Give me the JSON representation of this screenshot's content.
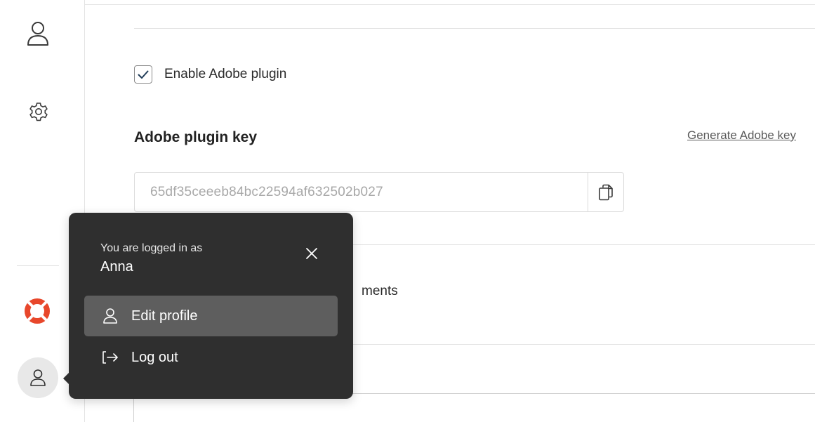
{
  "sidebar": {
    "icons": {
      "profile": "user-icon",
      "settings": "gear-icon",
      "help": "lifebuoy-icon",
      "account": "user-icon"
    },
    "help_colors": [
      "#e8472b",
      "#ffffff"
    ]
  },
  "settings": {
    "enable_adobe_label": "Enable Adobe plugin",
    "enable_adobe_checked": true,
    "plugin_key_title": "Adobe plugin key",
    "generate_key_link": "Generate Adobe key",
    "plugin_key_value": "65df35ceeeb84bc22594af632502b027",
    "partial_text": "ments"
  },
  "user_menu": {
    "logged_in_label": "You are logged in as",
    "user_name": "Anna",
    "items": [
      {
        "label": "Edit profile",
        "icon": "user-icon",
        "active": true
      },
      {
        "label": "Log out",
        "icon": "logout-icon",
        "active": false
      }
    ]
  },
  "colors": {
    "popup_bg": "#2f2f2f",
    "active_item_bg": "#5e5e5e",
    "checkbox_check": "#1f3b57"
  }
}
